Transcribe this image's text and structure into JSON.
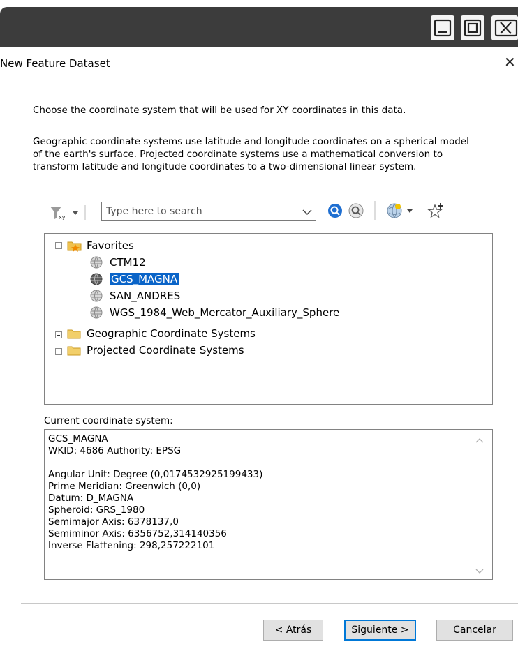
{
  "window": {
    "title": "New Feature Dataset",
    "controls": [
      "minimize-icon",
      "maximize-icon",
      "close-icon"
    ]
  },
  "intro": {
    "line1": "Choose the coordinate system that will be used for XY coordinates in this data.",
    "line2": "Geographic coordinate systems use latitude and longitude coordinates on a spherical model",
    "line3": "of the earth's surface. Projected coordinate systems use a mathematical conversion to",
    "line4": "transform latitude and longitude coordinates to a two-dimensional linear system."
  },
  "toolbar": {
    "search_placeholder": "Type here to search",
    "icons": [
      "filter-icon",
      "search-icon",
      "clear-search-icon",
      "globe-icon",
      "add-favorite-icon"
    ]
  },
  "tree": {
    "favorites": "Favorites",
    "favorite_items": [
      "CTM12",
      "GCS_MAGNA",
      "SAN_ANDRES",
      "WGS_1984_Web_Mercator_Auxiliary_Sphere"
    ],
    "selected": "GCS_MAGNA",
    "geographic": "Geographic Coordinate Systems",
    "projected": "Projected Coordinate Systems"
  },
  "current": {
    "label": "Current coordinate system:",
    "lines": [
      "GCS_MAGNA",
      "WKID: 4686 Authority: EPSG",
      "",
      "Angular Unit: Degree (0,0174532925199433)",
      "Prime Meridian: Greenwich (0,0)",
      "Datum: D_MAGNA",
      "  Spheroid: GRS_1980",
      "    Semimajor Axis: 6378137,0",
      "    Semiminor Axis: 6356752,314140356",
      "    Inverse Flattening: 298,257222101"
    ]
  },
  "buttons": {
    "back": "< Atrás",
    "next": "Siguiente >",
    "cancel": "Cancelar"
  },
  "colors": {
    "selection": "#0a64c8",
    "title_bar": "#3c3c3c"
  }
}
